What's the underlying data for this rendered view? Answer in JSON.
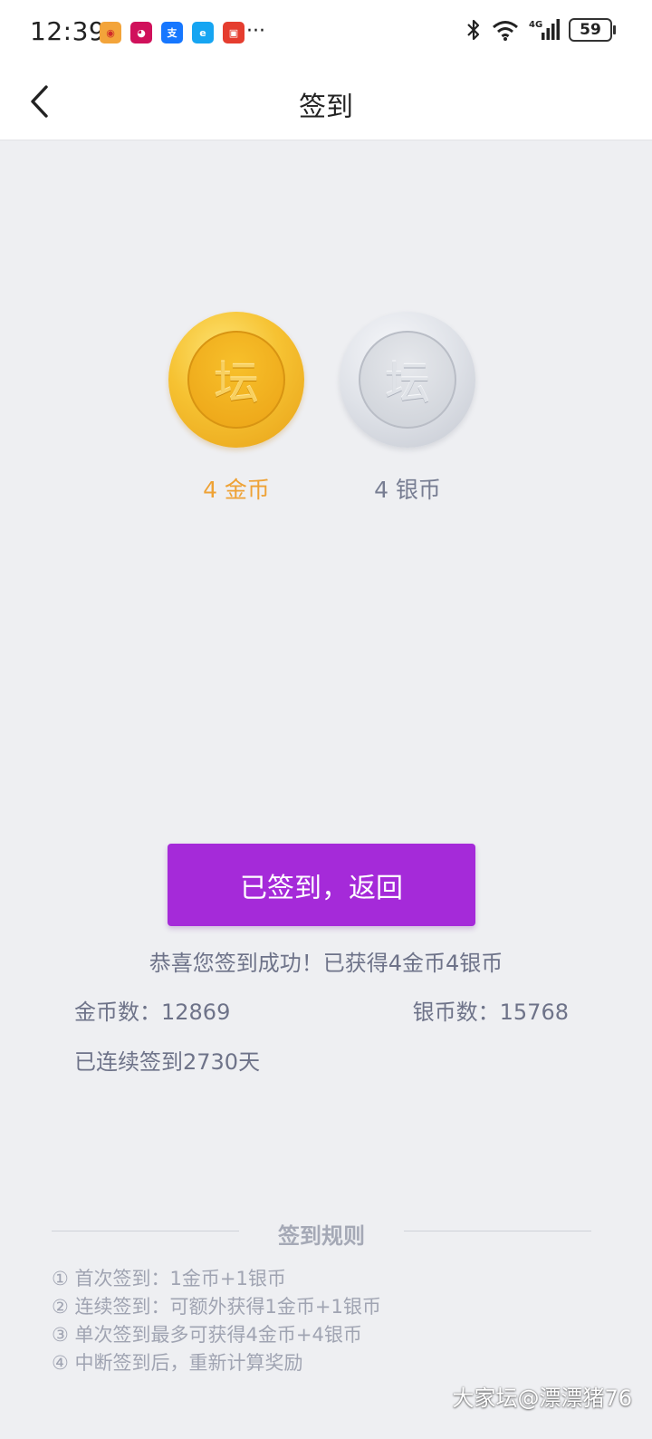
{
  "status_bar": {
    "time": "12:39",
    "more": "···",
    "battery": "59",
    "network": "4G",
    "notification_icons": [
      "weibo-icon",
      "tmall-icon",
      "alipay-icon",
      "eleme-icon",
      "app-icon"
    ]
  },
  "nav": {
    "title": "签到"
  },
  "coins": {
    "gold_glyph": "坛",
    "silver_glyph": "坛",
    "gold_label": "4 金币",
    "silver_label": "4 银币"
  },
  "button": {
    "label": "已签到，返回"
  },
  "result": {
    "message": "恭喜您签到成功！已获得4金币4银币",
    "gold_count": "金币数：12869",
    "silver_count": "银币数：15768",
    "streak": "已连续签到2730天"
  },
  "rules": {
    "title": "签到规则",
    "items": [
      "① 首次签到：1金币+1银币",
      "② 连续签到：可额外获得1金币+1银币",
      "③ 单次签到最多可获得4金币+4银币",
      "④ 中断签到后，重新计算奖励"
    ]
  },
  "watermark": "大家坛@漂漂猪76",
  "colors": {
    "button": "#a52ad9",
    "gold_label": "#eea235",
    "background": "#eeeff2"
  }
}
